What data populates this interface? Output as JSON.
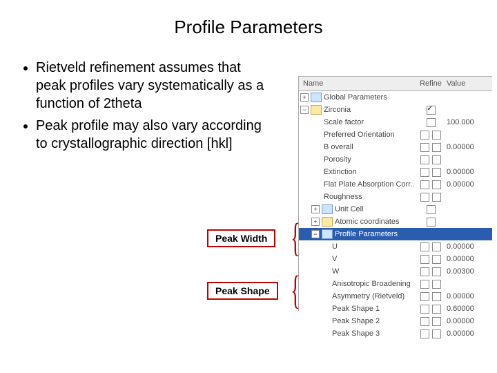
{
  "title": "Profile Parameters",
  "bullets": [
    "Rietveld refinement assumes that peak profiles vary systematically as a function of 2theta",
    "Peak profile may also vary according to crystallographic direction [hkl]"
  ],
  "callouts": {
    "peak_width": "Peak Width",
    "peak_shape": "Peak Shape"
  },
  "tree_header": {
    "name": "Name",
    "refine": "Refine",
    "value": "Value"
  },
  "tree": {
    "global": "Global Parameters",
    "phase": "Zirconia",
    "phase_items": [
      {
        "label": "Scale factor",
        "refine_count": 1,
        "value": "100.000"
      },
      {
        "label": "Preferred Orientation",
        "refine_count": 2,
        "value": ""
      },
      {
        "label": "B overall",
        "refine_count": 2,
        "value": "0.00000"
      },
      {
        "label": "Porosity",
        "refine_count": 2,
        "value": ""
      },
      {
        "label": "Extinction",
        "refine_count": 2,
        "value": "0.00000"
      },
      {
        "label": "Flat Plate Absorption Corr..",
        "refine_count": 2,
        "value": "0.00000"
      },
      {
        "label": "Roughness",
        "refine_count": 2,
        "value": ""
      }
    ],
    "unit_cell": "Unit Cell",
    "atomic": "Atomic coordinates",
    "profile": "Profile Parameters",
    "profile_items": [
      {
        "label": "U",
        "refine_count": 2,
        "value": "0.00000"
      },
      {
        "label": "V",
        "refine_count": 2,
        "value": "0.00000"
      },
      {
        "label": "W",
        "refine_count": 2,
        "value": "0.00300"
      },
      {
        "label": "Anisotropic Broadening",
        "refine_count": 2,
        "value": ""
      },
      {
        "label": "Asymmetry (Rietveld)",
        "refine_count": 2,
        "value": "0.00000"
      },
      {
        "label": "Peak Shape 1",
        "refine_count": 2,
        "value": "0.60000"
      },
      {
        "label": "Peak Shape 2",
        "refine_count": 2,
        "value": "0.00000"
      },
      {
        "label": "Peak Shape 3",
        "refine_count": 2,
        "value": "0.00000"
      }
    ]
  }
}
